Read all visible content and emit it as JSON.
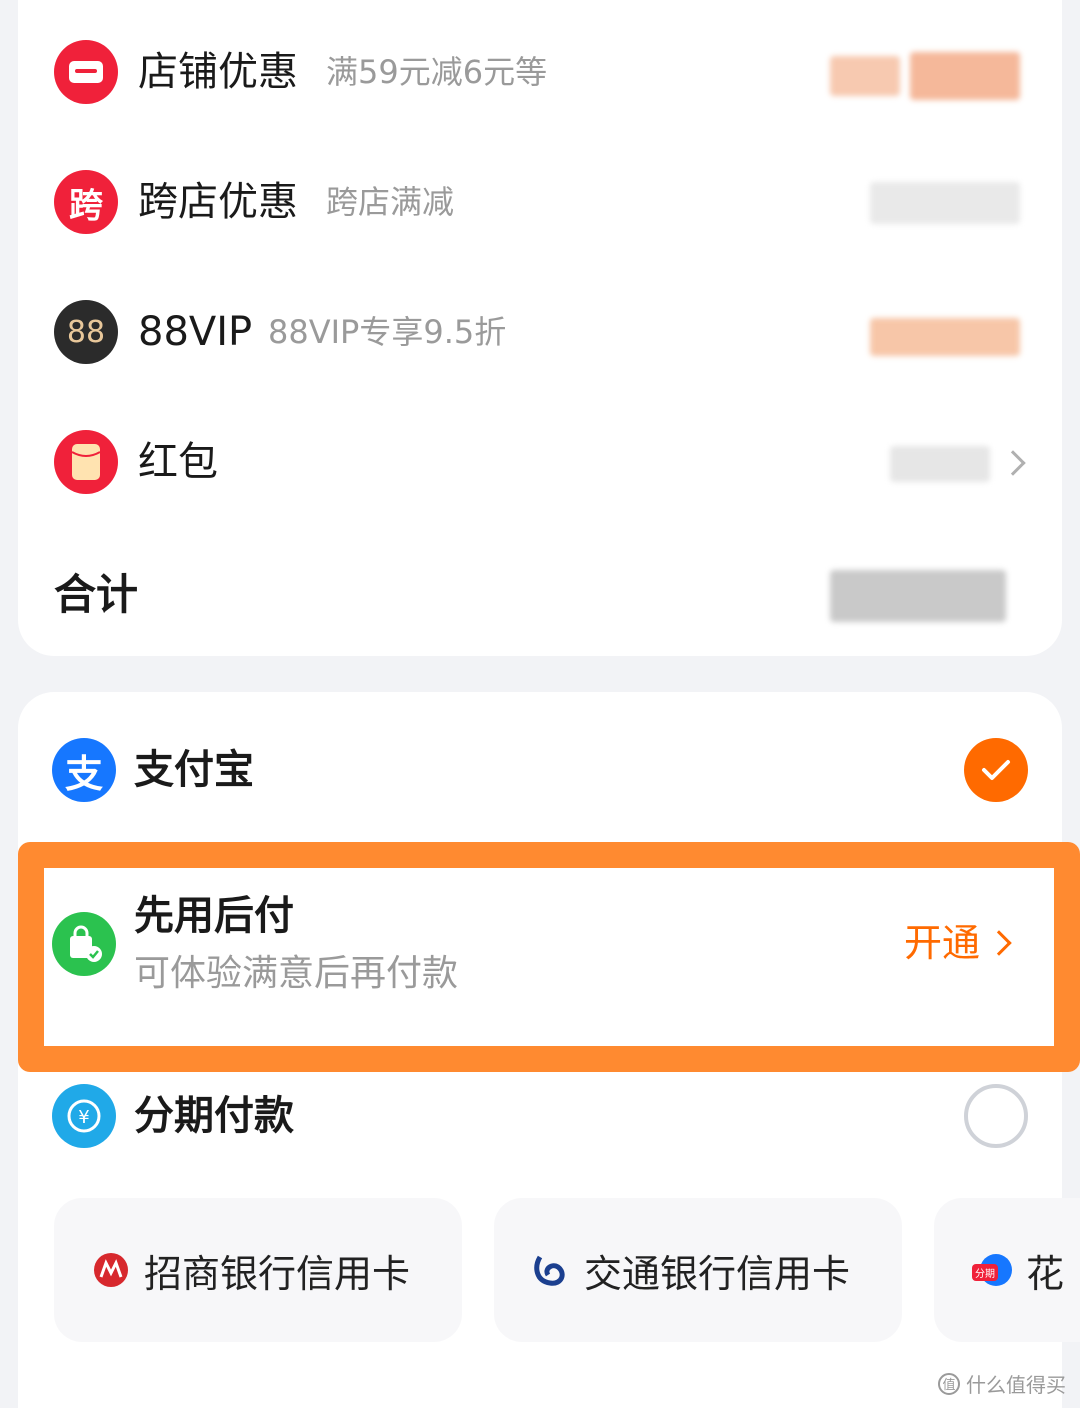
{
  "discounts": [
    {
      "icon": "shop-coupon-icon",
      "title": "店铺优惠",
      "subtitle": "满59元减6元等",
      "color": "#f0213a"
    },
    {
      "icon": "cross-store-icon",
      "glyph": "跨",
      "title": "跨店优惠",
      "subtitle": "跨店满减",
      "color": "#f0213a"
    },
    {
      "icon": "vip-88-icon",
      "glyph": "88",
      "title": "88VIP",
      "subtitle": "88VIP专享9.5折",
      "color": "#2b2b2b"
    },
    {
      "icon": "red-packet-icon",
      "glyph": "¥",
      "title": "红包",
      "subtitle": "",
      "color": "#f0213a"
    }
  ],
  "total_label": "合计",
  "payment": {
    "alipay": {
      "label": "支付宝",
      "icon_glyph": "支",
      "color": "#1677ff"
    },
    "buy_now_pay_later": {
      "label": "先用后付",
      "subtitle": "可体验满意后再付款",
      "action": "开通",
      "color": "#2bc24f"
    },
    "installment": {
      "label": "分期付款",
      "icon_glyph": "¥",
      "color": "#20a9e8"
    },
    "cards": [
      {
        "label": "招商银行信用卡",
        "icon": "cmb-bank-icon",
        "color": "#d7282d"
      },
      {
        "label": "交通银行信用卡",
        "icon": "bocom-bank-icon",
        "color": "#1b3f8f"
      },
      {
        "label": "花",
        "icon": "huabei-installment-icon",
        "color": "#1677ff",
        "badge": "分期"
      }
    ]
  },
  "accent": "#ff6a00",
  "highlight_color": "#ff8a30",
  "watermark": "什么值得买",
  "watermark_glyph": "值"
}
